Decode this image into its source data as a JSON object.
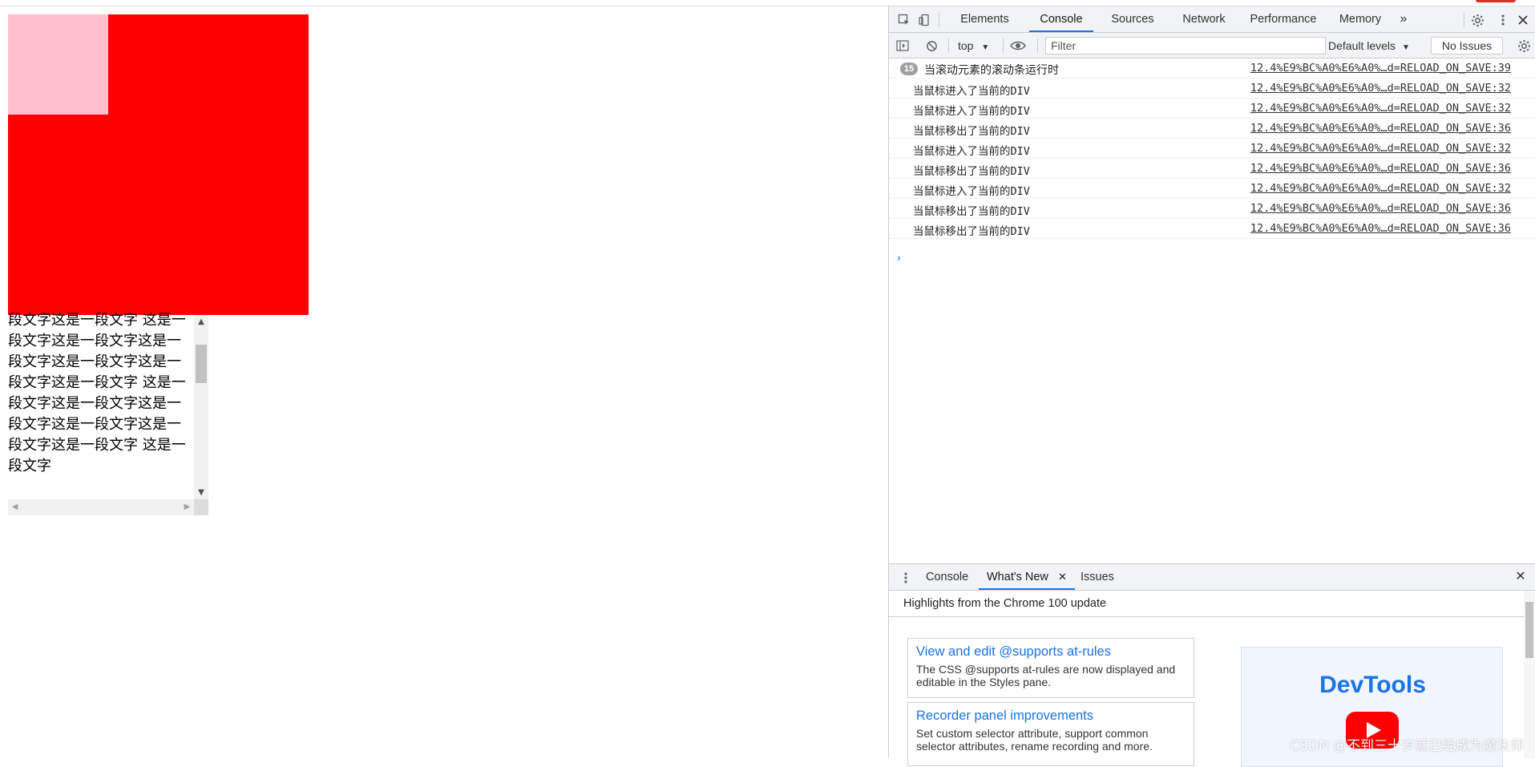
{
  "page": {
    "scroll_text": "段文字这是一段文字 这是一段文字这是一段文字这是一段文字这是一段文字这是一段文字这是一段文字 这是一段文字这是一段文字这是一段文字这是一段文字这是一段文字这是一段文字 这是一段文字"
  },
  "devtools": {
    "tabs": [
      "Elements",
      "Console",
      "Sources",
      "Network",
      "Performance",
      "Memory"
    ],
    "more_tabs": "»",
    "toolbar": {
      "context": "top",
      "filter_placeholder": "Filter",
      "levels": "Default levels",
      "issues": "No Issues"
    },
    "log": [
      {
        "count": "15",
        "message": "当滚动元素的滚动条运行时",
        "source": "12.4%E9%BC%A0%E6%A0%…d=RELOAD_ON_SAVE:39"
      },
      {
        "message": "当鼠标进入了当前的DIV",
        "source": "12.4%E9%BC%A0%E6%A0%…d=RELOAD_ON_SAVE:32"
      },
      {
        "message": "当鼠标进入了当前的DIV",
        "source": "12.4%E9%BC%A0%E6%A0%…d=RELOAD_ON_SAVE:32"
      },
      {
        "message": "当鼠标移出了当前的DIV",
        "source": "12.4%E9%BC%A0%E6%A0%…d=RELOAD_ON_SAVE:36"
      },
      {
        "message": "当鼠标进入了当前的DIV",
        "source": "12.4%E9%BC%A0%E6%A0%…d=RELOAD_ON_SAVE:32"
      },
      {
        "message": "当鼠标移出了当前的DIV",
        "source": "12.4%E9%BC%A0%E6%A0%…d=RELOAD_ON_SAVE:36"
      },
      {
        "message": "当鼠标进入了当前的DIV",
        "source": "12.4%E9%BC%A0%E6%A0%…d=RELOAD_ON_SAVE:32"
      },
      {
        "message": "当鼠标移出了当前的DIV",
        "source": "12.4%E9%BC%A0%E6%A0%…d=RELOAD_ON_SAVE:36"
      },
      {
        "message": "当鼠标移出了当前的DIV",
        "source": "12.4%E9%BC%A0%E6%A0%…d=RELOAD_ON_SAVE:36"
      }
    ],
    "prompt": "›",
    "drawer": {
      "tabs": [
        "Console",
        "What's New",
        "Issues"
      ],
      "highlights": "Highlights from the Chrome 100 update",
      "cards": [
        {
          "title": "View and edit @supports at-rules",
          "desc": "The CSS @supports at-rules are now displayed and editable in the Styles pane."
        },
        {
          "title": "Recorder panel improvements",
          "desc": "Set custom selector attribute, support common selector attributes, rename recording and more."
        }
      ],
      "video_logo": "DevTools"
    }
  },
  "watermark": "CSDN @不到三十岁就已经成为魔法师",
  "colors": {
    "red_box": "#ff0000",
    "pink_box": "#ffc0cb",
    "accent": "#1a73e8"
  }
}
